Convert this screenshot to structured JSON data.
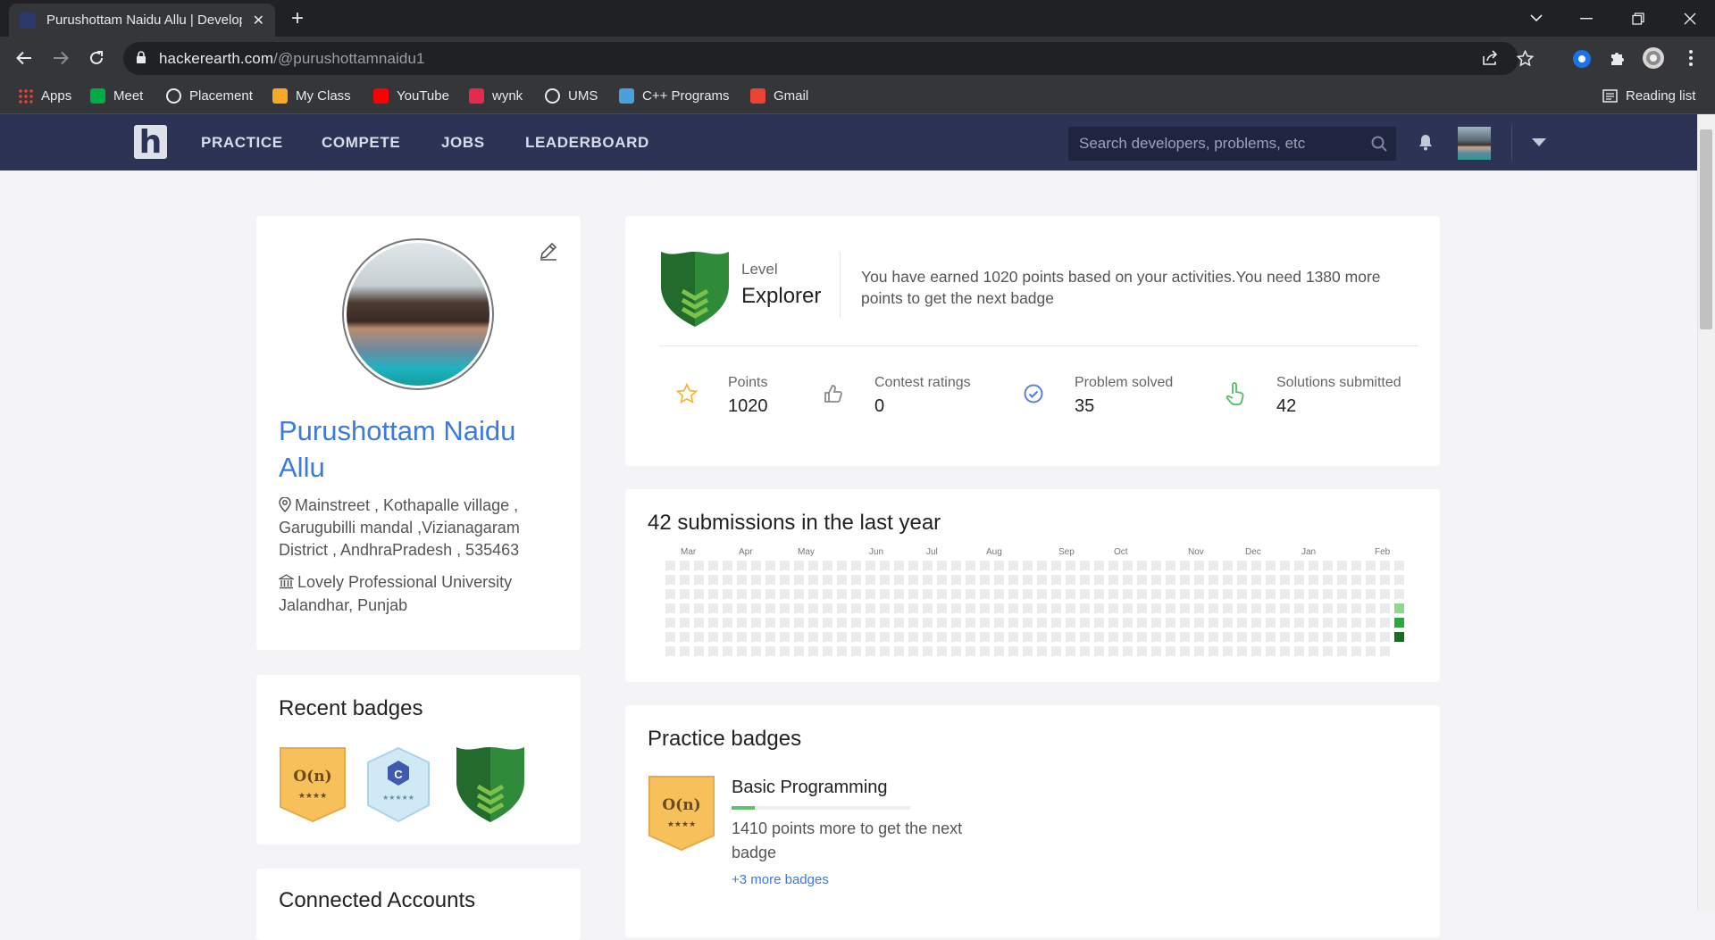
{
  "browser": {
    "tab_title": "Purushottam Naidu Allu | Developer Profile on HackerEarth",
    "url_host": "hackerearth.com",
    "url_path": "/@purushottamnaidu1",
    "bookmarks": [
      {
        "label": "Apps",
        "icon": "apps-grid-icon",
        "color": "#4285f4"
      },
      {
        "label": "Meet",
        "icon": "meet-icon",
        "color": "#00ac47"
      },
      {
        "label": "Placement",
        "icon": "globe-icon",
        "color": "#e8eaed"
      },
      {
        "label": "My Class",
        "icon": "sun-icon",
        "color": "#f9a825"
      },
      {
        "label": "YouTube",
        "icon": "youtube-icon",
        "color": "#ff0000"
      },
      {
        "label": "wynk",
        "icon": "wynk-icon",
        "color": "#e52b4d"
      },
      {
        "label": "UMS",
        "icon": "globe-icon",
        "color": "#e8eaed"
      },
      {
        "label": "C++ Programs",
        "icon": "cpp-icon",
        "color": "#4aa0d8"
      },
      {
        "label": "Gmail",
        "icon": "gmail-icon",
        "color": "#ea4335"
      }
    ],
    "reading_list": "Reading list"
  },
  "nav": {
    "logo": "h",
    "links": [
      "PRACTICE",
      "COMPETE",
      "JOBS",
      "LEADERBOARD"
    ],
    "search_placeholder": "Search developers, problems, etc"
  },
  "profile": {
    "name": "Purushottam Naidu Allu",
    "address": "Mainstreet , Kothapalle village , Garugubilli mandal ,Vizianagaram District , AndhraPradesh , 535463",
    "university": "Lovely Professional University Jalandhar, Punjab"
  },
  "recent_badges": {
    "title": "Recent badges",
    "badges": [
      {
        "icon": "big-o-badge-icon",
        "text": "O(n)",
        "stars": "★★★★",
        "color": "#f7c05a"
      },
      {
        "icon": "c-language-badge-icon",
        "text": "C",
        "stars": "★★★★★",
        "color": "#cfe9f5"
      },
      {
        "icon": "explorer-shield-icon",
        "color": "#2f8a3a"
      }
    ]
  },
  "connected": {
    "title": "Connected Accounts"
  },
  "level": {
    "label": "Level",
    "name": "Explorer",
    "message": "You have earned 1020 points based on your activities.You need 1380 more points to get the next badge",
    "stats": [
      {
        "label": "Points",
        "value": "1020",
        "icon": "star-icon",
        "bg": "#fff5dd",
        "fg": "#f5b83d"
      },
      {
        "label": "Contest ratings",
        "value": "0",
        "icon": "thumbs-up-icon",
        "bg": "#ebebeb",
        "fg": "#8a8a8a"
      },
      {
        "label": "Problem solved",
        "value": "35",
        "icon": "check-circle-icon",
        "bg": "#e6ecfc",
        "fg": "#5b7fe0"
      },
      {
        "label": "Solutions submitted",
        "value": "42",
        "icon": "pointer-hand-icon",
        "bg": "#e6f7ea",
        "fg": "#4cbf6a"
      }
    ]
  },
  "submissions": {
    "title": "42 submissions in the last year",
    "months": [
      "Mar",
      "Apr",
      "May",
      "Jun",
      "Jul",
      "Aug",
      "Sep",
      "Oct",
      "Nov",
      "Dec",
      "Jan",
      "Feb"
    ],
    "empty_color": "#ebebeb",
    "active_cells": [
      {
        "week": 51,
        "day": 3,
        "color": "#8fd88f"
      },
      {
        "week": 51,
        "day": 4,
        "color": "#2fa63a"
      },
      {
        "week": 51,
        "day": 5,
        "color": "#1a6b23"
      }
    ]
  },
  "practice": {
    "title": "Practice badges",
    "badge_text": "O(n)",
    "badge_stars": "★★★★",
    "badge_name": "Basic Programming",
    "progress": 0.13,
    "message": "1410 points more to get the next badge",
    "more": "+3 more badges"
  }
}
